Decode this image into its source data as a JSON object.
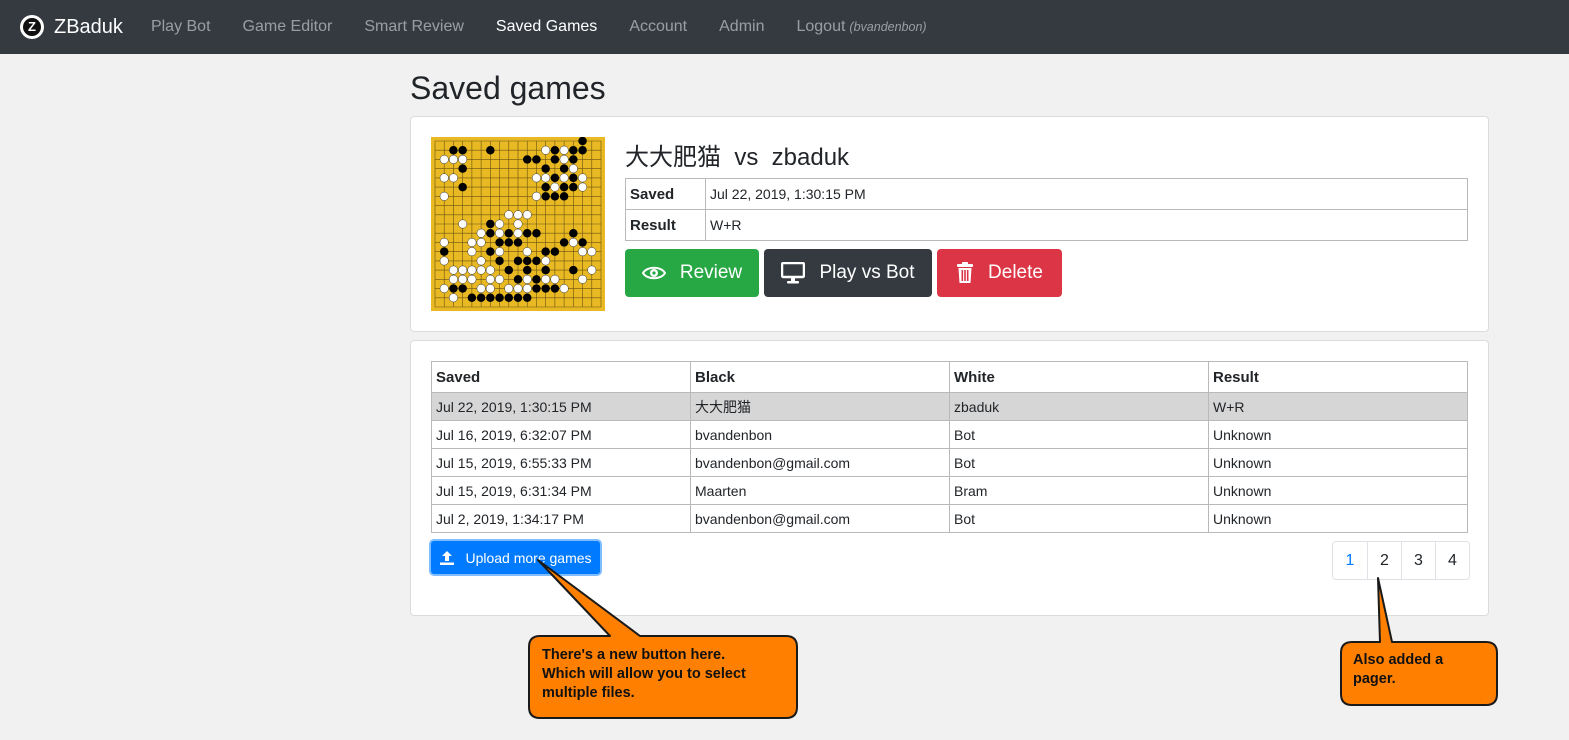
{
  "nav": {
    "brand": "ZBaduk",
    "brand_glyph": "Z",
    "items": [
      {
        "label": "Play Bot",
        "active": false
      },
      {
        "label": "Game Editor",
        "active": false
      },
      {
        "label": "Smart Review",
        "active": false
      },
      {
        "label": "Saved Games",
        "active": true
      },
      {
        "label": "Account",
        "active": false
      },
      {
        "label": "Admin",
        "active": false
      },
      {
        "label": "Logout",
        "active": false
      }
    ],
    "user": "(bvandenbon)"
  },
  "page": {
    "title": "Saved games"
  },
  "selected_game": {
    "black": "大大肥猫",
    "vs": "vs",
    "white": "zbaduk",
    "title": "大大肥猫  vs  zbaduk",
    "saved_label": "Saved",
    "saved_value": "Jul 22, 2019, 1:30:15 PM",
    "result_label": "Result",
    "result_value": "W+R",
    "buttons": {
      "review": "Review",
      "play": "Play vs Bot",
      "delete": "Delete"
    }
  },
  "games_table": {
    "headers": [
      "Saved",
      "Black",
      "White",
      "Result"
    ],
    "rows": [
      [
        "Jul 22, 2019, 1:30:15 PM",
        "大大肥猫",
        "zbaduk",
        "W+R"
      ],
      [
        "Jul 16, 2019, 6:32:07 PM",
        "bvandenbon",
        "Bot",
        "Unknown"
      ],
      [
        "Jul 15, 2019, 6:55:33 PM",
        "bvandenbon@gmail.com",
        "Bot",
        "Unknown"
      ],
      [
        "Jul 15, 2019, 6:31:34 PM",
        "Maarten",
        "Bram",
        "Unknown"
      ],
      [
        "Jul 2, 2019, 1:34:17 PM",
        "bvandenbon@gmail.com",
        "Bot",
        "Unknown"
      ]
    ]
  },
  "upload_button": "Upload more games",
  "pager": {
    "pages": [
      "1",
      "2",
      "3",
      "4"
    ],
    "current": "1"
  },
  "callouts": {
    "upload": [
      "There's a new button here.",
      "Which will allow you to select",
      "multiple files."
    ],
    "pager": [
      "Also added a",
      "pager."
    ]
  },
  "colors": {
    "navbar": "#343a40",
    "review": "#28a745",
    "play": "#343a40",
    "delete": "#dc3545",
    "upload": "#007bff",
    "callout": "#ff7f00",
    "board": "#e8b923"
  },
  "board": {
    "size": 19,
    "black": [
      [
        2,
        1
      ],
      [
        3,
        1
      ],
      [
        3,
        2
      ],
      [
        6,
        1
      ],
      [
        10,
        2
      ],
      [
        11,
        2
      ],
      [
        13,
        1
      ],
      [
        13,
        2
      ],
      [
        15,
        1
      ],
      [
        15,
        2
      ],
      [
        16,
        0
      ],
      [
        16,
        1
      ],
      [
        12,
        3
      ],
      [
        14,
        3
      ],
      [
        13,
        4
      ],
      [
        15,
        4
      ],
      [
        12,
        5
      ],
      [
        12,
        6
      ],
      [
        13,
        6
      ],
      [
        14,
        5
      ],
      [
        15,
        5
      ],
      [
        14,
        6
      ],
      [
        3,
        5
      ],
      [
        6,
        9
      ],
      [
        6,
        10
      ],
      [
        7,
        11
      ],
      [
        8,
        11
      ],
      [
        10,
        10
      ],
      [
        11,
        10
      ],
      [
        12,
        12
      ],
      [
        13,
        12
      ],
      [
        14,
        11
      ],
      [
        16,
        11
      ],
      [
        15,
        10
      ],
      [
        11,
        13
      ],
      [
        10,
        13
      ],
      [
        9,
        13
      ],
      [
        8,
        14
      ],
      [
        9,
        15
      ],
      [
        12,
        14
      ],
      [
        15,
        14
      ],
      [
        2,
        16
      ],
      [
        3,
        16
      ],
      [
        4,
        17
      ],
      [
        5,
        17
      ],
      [
        6,
        17
      ],
      [
        7,
        17
      ],
      [
        8,
        17
      ],
      [
        9,
        17
      ],
      [
        10,
        17
      ],
      [
        11,
        16
      ],
      [
        12,
        16
      ],
      [
        13,
        16
      ],
      [
        8,
        10
      ],
      [
        9,
        11
      ],
      [
        6,
        12
      ],
      [
        7,
        13
      ],
      [
        10,
        14
      ],
      [
        11,
        15
      ],
      [
        1,
        12
      ],
      [
        3,
        3
      ]
    ],
    "white": [
      [
        1,
        2
      ],
      [
        2,
        2
      ],
      [
        3,
        2
      ],
      [
        2,
        4
      ],
      [
        1,
        4
      ],
      [
        1,
        6
      ],
      [
        3,
        9
      ],
      [
        1,
        11
      ],
      [
        1,
        13
      ],
      [
        2,
        15
      ],
      [
        3,
        15
      ],
      [
        4,
        15
      ],
      [
        12,
        1
      ],
      [
        14,
        1
      ],
      [
        14,
        2
      ],
      [
        15,
        3
      ],
      [
        16,
        4
      ],
      [
        11,
        4
      ],
      [
        12,
        4
      ],
      [
        14,
        4
      ],
      [
        13,
        5
      ],
      [
        11,
        6
      ],
      [
        16,
        5
      ],
      [
        8,
        8
      ],
      [
        9,
        8
      ],
      [
        10,
        8
      ],
      [
        7,
        9
      ],
      [
        9,
        9
      ],
      [
        9,
        10
      ],
      [
        7,
        10
      ],
      [
        5,
        10
      ],
      [
        4,
        11
      ],
      [
        5,
        11
      ],
      [
        4,
        12
      ],
      [
        7,
        12
      ],
      [
        5,
        14
      ],
      [
        6,
        14
      ],
      [
        4,
        14
      ],
      [
        6,
        15
      ],
      [
        7,
        15
      ],
      [
        3,
        14
      ],
      [
        8,
        16
      ],
      [
        9,
        16
      ],
      [
        10,
        16
      ],
      [
        6,
        16
      ],
      [
        12,
        15
      ],
      [
        13,
        15
      ],
      [
        2,
        17
      ],
      [
        14,
        16
      ],
      [
        12,
        13
      ],
      [
        16,
        12
      ],
      [
        17,
        12
      ],
      [
        17,
        14
      ],
      [
        16,
        15
      ],
      [
        15,
        11
      ],
      [
        10,
        15
      ],
      [
        5,
        16
      ],
      [
        1,
        16
      ],
      [
        2,
        14
      ],
      [
        5,
        13
      ],
      [
        10,
        12
      ]
    ]
  }
}
